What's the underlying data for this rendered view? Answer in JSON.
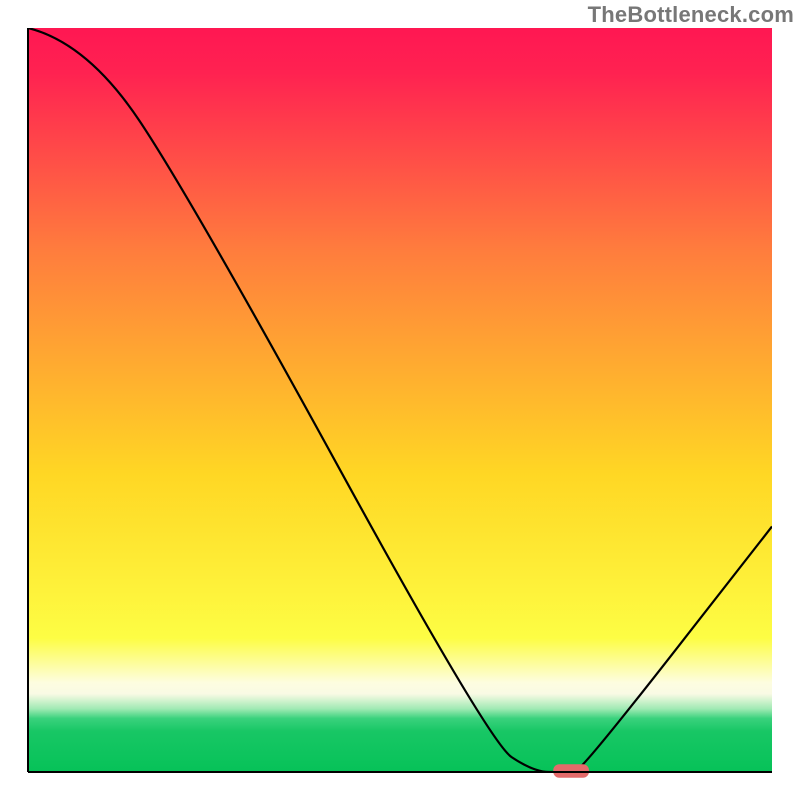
{
  "watermark": "TheBottleneck.com",
  "chart_data": {
    "type": "line",
    "title": "",
    "xlabel": "",
    "ylabel": "",
    "xlim": [
      0,
      100
    ],
    "ylim": [
      0,
      100
    ],
    "grid": false,
    "legend": false,
    "gradient_stops": [
      {
        "offset": 0.0,
        "color": "#ff1752"
      },
      {
        "offset": 0.06,
        "color": "#ff2251"
      },
      {
        "offset": 0.3,
        "color": "#ff7d3d"
      },
      {
        "offset": 0.6,
        "color": "#ffd724"
      },
      {
        "offset": 0.82,
        "color": "#fdfd44"
      },
      {
        "offset": 0.88,
        "color": "#fdfde0"
      },
      {
        "offset": 0.895,
        "color": "#f9fae4"
      },
      {
        "offset": 0.915,
        "color": "#a1eab4"
      },
      {
        "offset": 0.928,
        "color": "#3ad27d"
      },
      {
        "offset": 0.945,
        "color": "#18c765"
      },
      {
        "offset": 1.0,
        "color": "#06c258"
      }
    ],
    "series": [
      {
        "name": "bottleneck-curve",
        "x": [
          0,
          8,
          22,
          62,
          68,
          72,
          73,
          75,
          100
        ],
        "y": [
          100,
          98,
          77,
          4,
          0,
          0,
          0,
          1,
          33
        ]
      }
    ],
    "marker": {
      "name": "optimal-marker",
      "x": 73,
      "y": 0,
      "width_pct": 4.8,
      "height_pct": 1.8,
      "color": "#e46a6a"
    },
    "axis_color": "#000000",
    "axis_width": 2
  }
}
